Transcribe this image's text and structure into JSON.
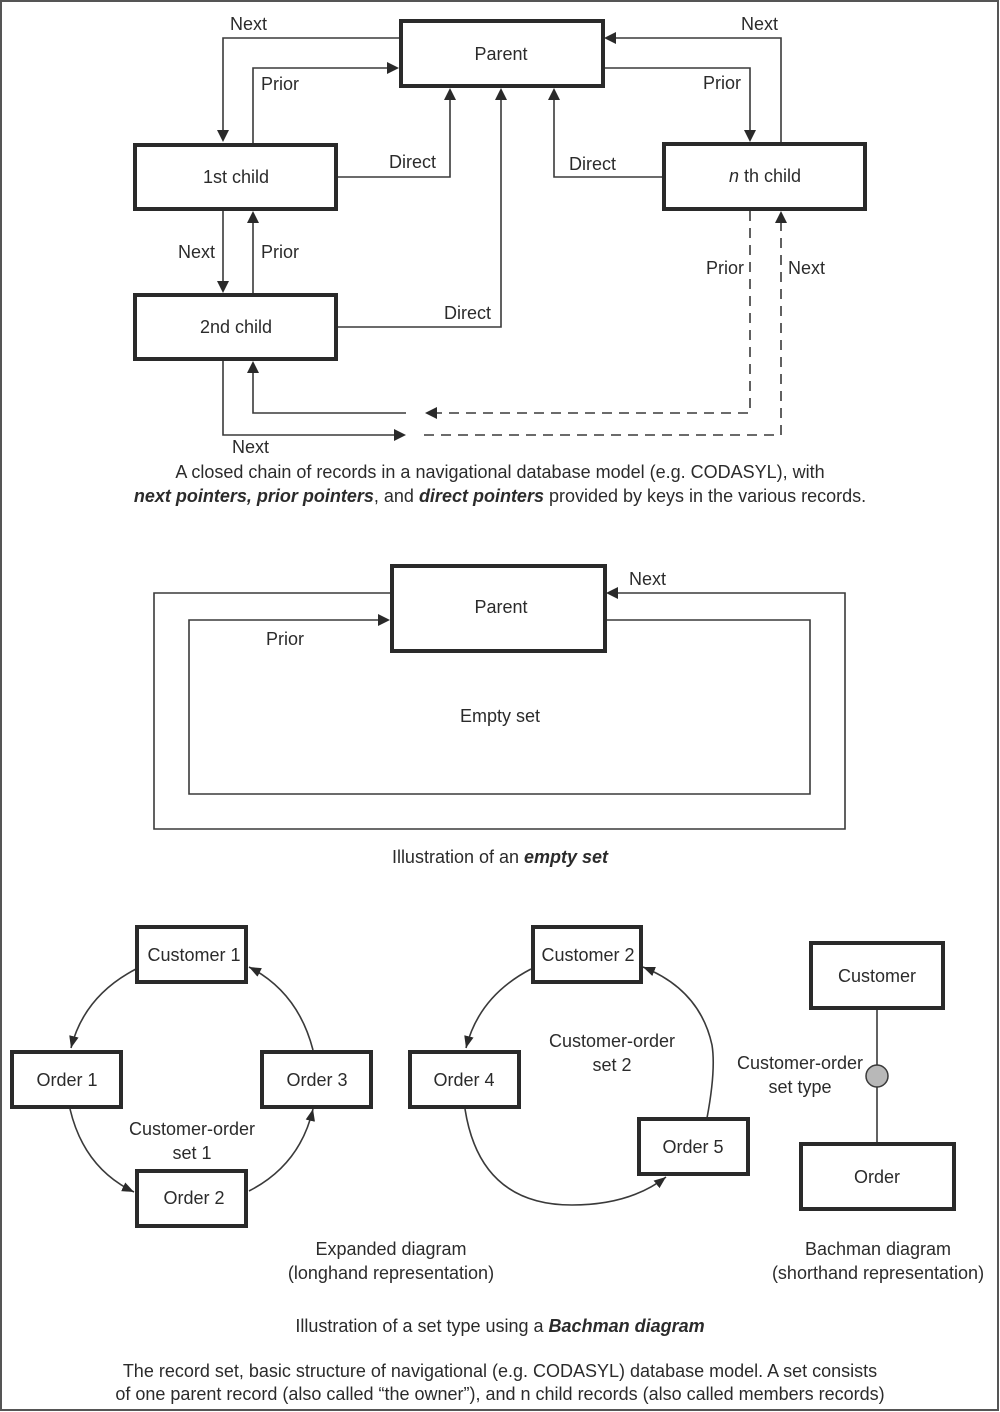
{
  "figure1": {
    "records": {
      "parent": "Parent",
      "first_child": "1st child",
      "second_child": "2nd child",
      "nth_child_italic": "n",
      "nth_child_rest": " th child"
    },
    "pointer_labels": {
      "next_top_left": "Next",
      "prior_top_left": "Prior",
      "direct_first": "Direct",
      "next_top_right": "Next",
      "prior_top_right": "Prior",
      "direct_nth": "Direct",
      "next_mid": "Next",
      "prior_mid": "Prior",
      "direct_second": "Direct",
      "prior_nth_dashed": "Prior",
      "next_nth_dashed": "Next",
      "next_bottom": "Next"
    },
    "caption": {
      "line1": "A closed chain of records in a navigational database model (e.g. CODASYL), with",
      "line2_b1": "next pointers, prior pointers",
      "line2_t1": ", and ",
      "line2_b2": "direct pointers",
      "line2_t2": " provided by keys in the various records."
    }
  },
  "figure2": {
    "parent": "Parent",
    "next_label": "Next",
    "prior_label": "Prior",
    "empty_label": "Empty set",
    "caption_text": "Illustration of an ",
    "caption_bold": "empty set"
  },
  "figure3": {
    "set1": {
      "owner": "Customer 1",
      "members": [
        "Order 1",
        "Order 2",
        "Order 3"
      ],
      "label_line1": "Customer-order",
      "label_line2": "set 1"
    },
    "set2": {
      "owner": "Customer 2",
      "members": [
        "Order 4",
        "Order 5"
      ],
      "label_line1": "Customer-order",
      "label_line2": "set 2"
    },
    "bachman": {
      "owner": "Customer",
      "member": "Order",
      "set_type_line1": "Customer-order",
      "set_type_line2": "set type",
      "circle_color": "#b8b8b8"
    },
    "expanded_caption_line1": "Expanded diagram",
    "expanded_caption_line2": "(longhand representation)",
    "bachman_caption_line1": "Bachman diagram",
    "bachman_caption_line2": "(shorthand representation)",
    "caption_text": "Illustration of a set type using a ",
    "caption_bold": "Bachman diagram"
  },
  "footer": {
    "line1": "The record set, basic structure of navigational (e.g. CODASYL) database model. A set consists",
    "line2": "of one parent record (also called “the owner”), and n child records (also called members records)"
  }
}
